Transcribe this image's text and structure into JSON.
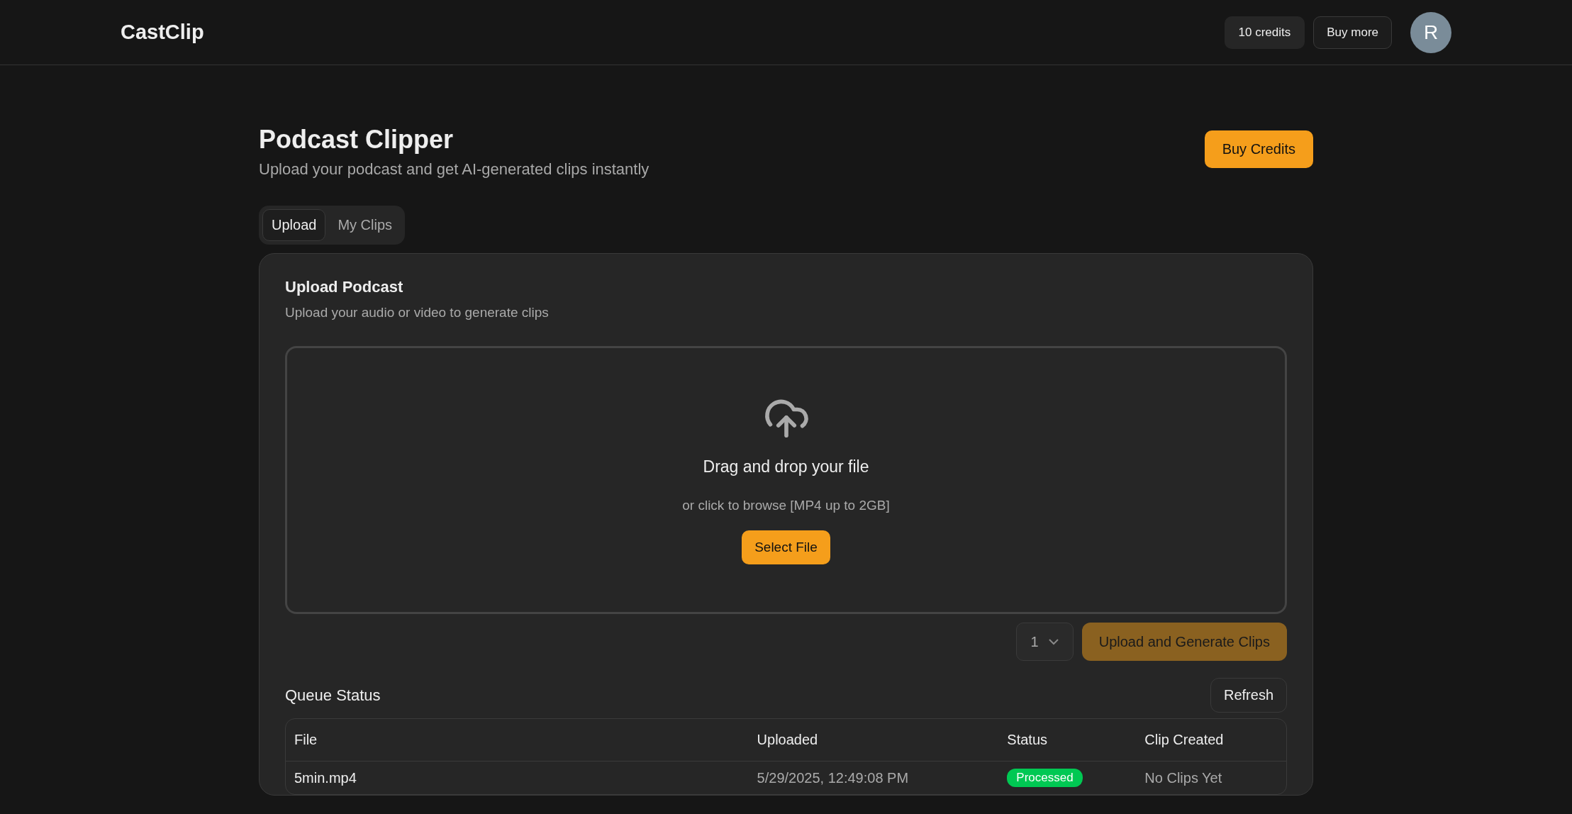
{
  "header": {
    "logo": "CastClip",
    "credits": "10 credits",
    "buy_more": "Buy more",
    "avatar": "R"
  },
  "page": {
    "title": "Podcast Clipper",
    "subtitle": "Upload your podcast and get AI-generated clips instantly",
    "buy_credits": "Buy Credits"
  },
  "tabs": [
    {
      "label": "Upload",
      "selected": true
    },
    {
      "label": "My Clips",
      "selected": false
    }
  ],
  "card": {
    "title": "Upload Podcast",
    "description": "Upload your audio or video to generate clips",
    "dropzone": {
      "title": "Drag and drop your file",
      "hint": "or click to browse [MP4 up to 2GB]",
      "button": "Select File"
    },
    "clip_count": {
      "value": "1"
    },
    "generate": {
      "label": "Upload and Generate Clips",
      "disabled": true
    },
    "queue": {
      "title": "Queue Status",
      "refresh": "Refresh",
      "columns": [
        "File",
        "Uploaded",
        "Status",
        "Clip Created"
      ],
      "rows": [
        {
          "file": "5min.mp4",
          "uploaded": "5/29/2025, 12:49:08 PM",
          "status": "Processed",
          "color": "#00c853",
          "clips": "No Clips Yet"
        }
      ]
    }
  }
}
